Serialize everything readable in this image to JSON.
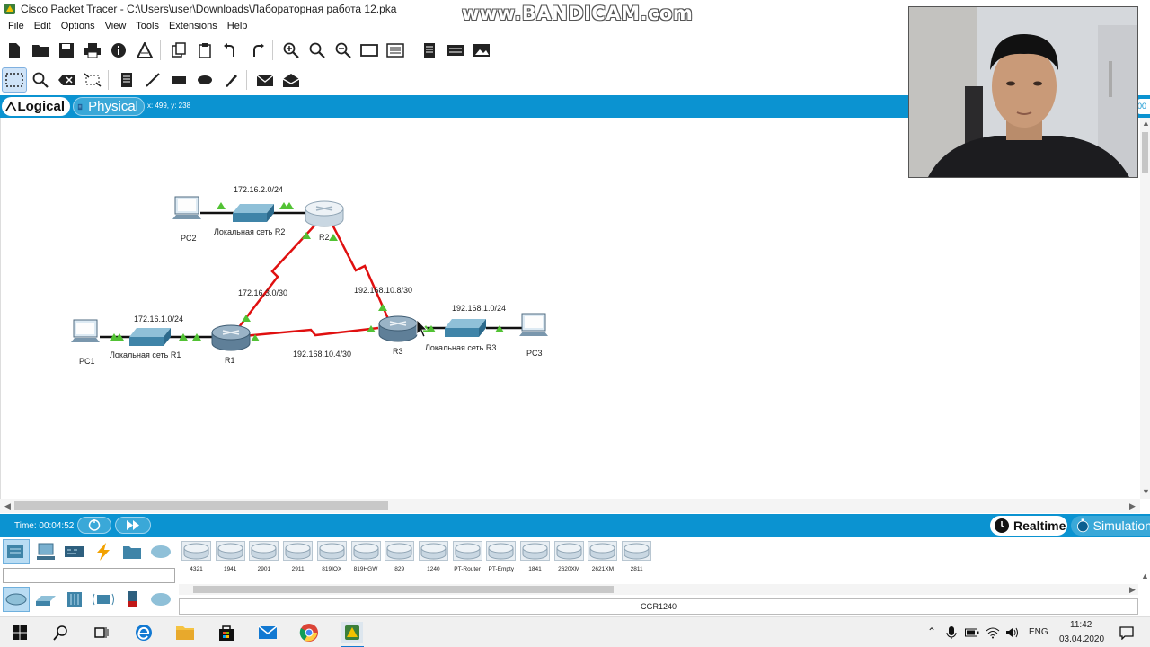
{
  "window": {
    "title": "Cisco Packet Tracer - C:\\Users\\user\\Downloads\\Лабораторная работа 12.pka"
  },
  "watermark": "www.BANDICAM.com",
  "menu": [
    "File",
    "Edit",
    "Options",
    "View",
    "Tools",
    "Extensions",
    "Help"
  ],
  "modes": {
    "logical": "Logical",
    "physical": "Physical",
    "coords": "x: 499, y: 238",
    "right_tab": "00"
  },
  "topology": {
    "devices": {
      "pc1": "PC1",
      "pc2": "PC2",
      "pc3": "PC3",
      "r1": "R1",
      "r2": "R2",
      "r3": "R3"
    },
    "lans": {
      "r1": "Локальная сеть R1",
      "r2": "Локальная сеть R2",
      "r3": "Локальная сеть R3"
    },
    "networks": {
      "n1": "172.16.1.0/24",
      "n2": "172.16.2.0/24",
      "n3": "192.168.1.0/24",
      "r1r2": "172.16.3.0/30",
      "r2r3": "192.168.10.8/30",
      "r1r3": "192.168.10.4/30"
    },
    "colors": {
      "ethernet": "#111111",
      "serial": "#e01010",
      "link_up": "#52c234"
    }
  },
  "timebar": {
    "time": "Time: 00:04:52",
    "realtime": "Realtime",
    "simulation": "Simulation"
  },
  "devices_panel": {
    "models": [
      "4321",
      "1941",
      "2901",
      "2911",
      "819IOX",
      "819HGW",
      "829",
      "1240",
      "PT-Router",
      "PT-Empty",
      "1841",
      "2620XM",
      "2621XM",
      "2811"
    ],
    "selected_model": "CGR1240"
  },
  "taskbar": {
    "lang": "ENG",
    "time": "11:42",
    "date": "03.04.2020"
  },
  "accent": "#0b93d1"
}
